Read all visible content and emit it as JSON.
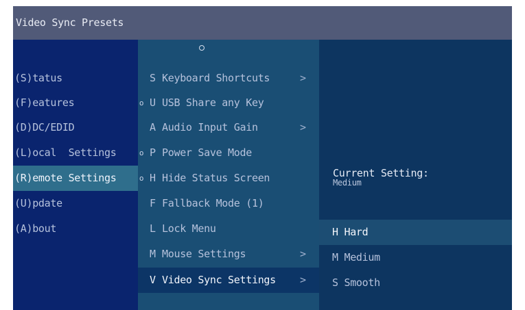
{
  "window": {
    "title": "Video Sync Presets"
  },
  "main_menu": {
    "items": [
      {
        "label": "(S)tatus",
        "selected": false
      },
      {
        "label": "(F)eatures",
        "selected": false
      },
      {
        "label": "(D)DC/EDID",
        "selected": false
      },
      {
        "label": "(L)ocal  Settings",
        "selected": false
      },
      {
        "label": "(R)emote Settings",
        "selected": true
      },
      {
        "label": "(U)pdate",
        "selected": false
      },
      {
        "label": "(A)bout",
        "selected": false
      }
    ]
  },
  "sub_menu": {
    "scroll_indicator_icon": "scroll-up-dot",
    "items": [
      {
        "key": "S",
        "label": "Keyboard Shortcuts",
        "dot": "",
        "arrow": ">"
      },
      {
        "key": "U",
        "label": "USB Share any Key",
        "dot": "o",
        "arrow": ""
      },
      {
        "key": "A",
        "label": "Audio Input Gain",
        "dot": "",
        "arrow": ">"
      },
      {
        "key": "P",
        "label": "Power Save Mode",
        "dot": "o",
        "arrow": ""
      },
      {
        "key": "H",
        "label": "Hide Status Screen",
        "dot": "o",
        "arrow": ""
      },
      {
        "key": "F",
        "label": "Fallback Mode (1)",
        "dot": "",
        "arrow": ""
      },
      {
        "key": "L",
        "label": "Lock Menu",
        "dot": "",
        "arrow": ""
      },
      {
        "key": "M",
        "label": "Mouse Settings",
        "dot": "",
        "arrow": ">"
      },
      {
        "key": "V",
        "label": "Video Sync Settings",
        "dot": "",
        "arrow": ">"
      }
    ]
  },
  "detail": {
    "current_setting_label": "Current Setting:",
    "current_setting_value": "Medium",
    "options": [
      {
        "key": "H",
        "label": "Hard",
        "selected": true
      },
      {
        "key": "M",
        "label": "Medium",
        "selected": false
      },
      {
        "key": "S",
        "label": "Smooth",
        "selected": false
      }
    ]
  },
  "colors": {
    "title_bar": "#515a78",
    "main_menu_bg": "#0a246e",
    "main_menu_selected": "#2f6e8c",
    "sub_menu_bg": "#1a4e74",
    "sub_menu_selected": "#0c3566",
    "detail_bg": "#0d3560",
    "detail_selected": "#1c4d73"
  }
}
